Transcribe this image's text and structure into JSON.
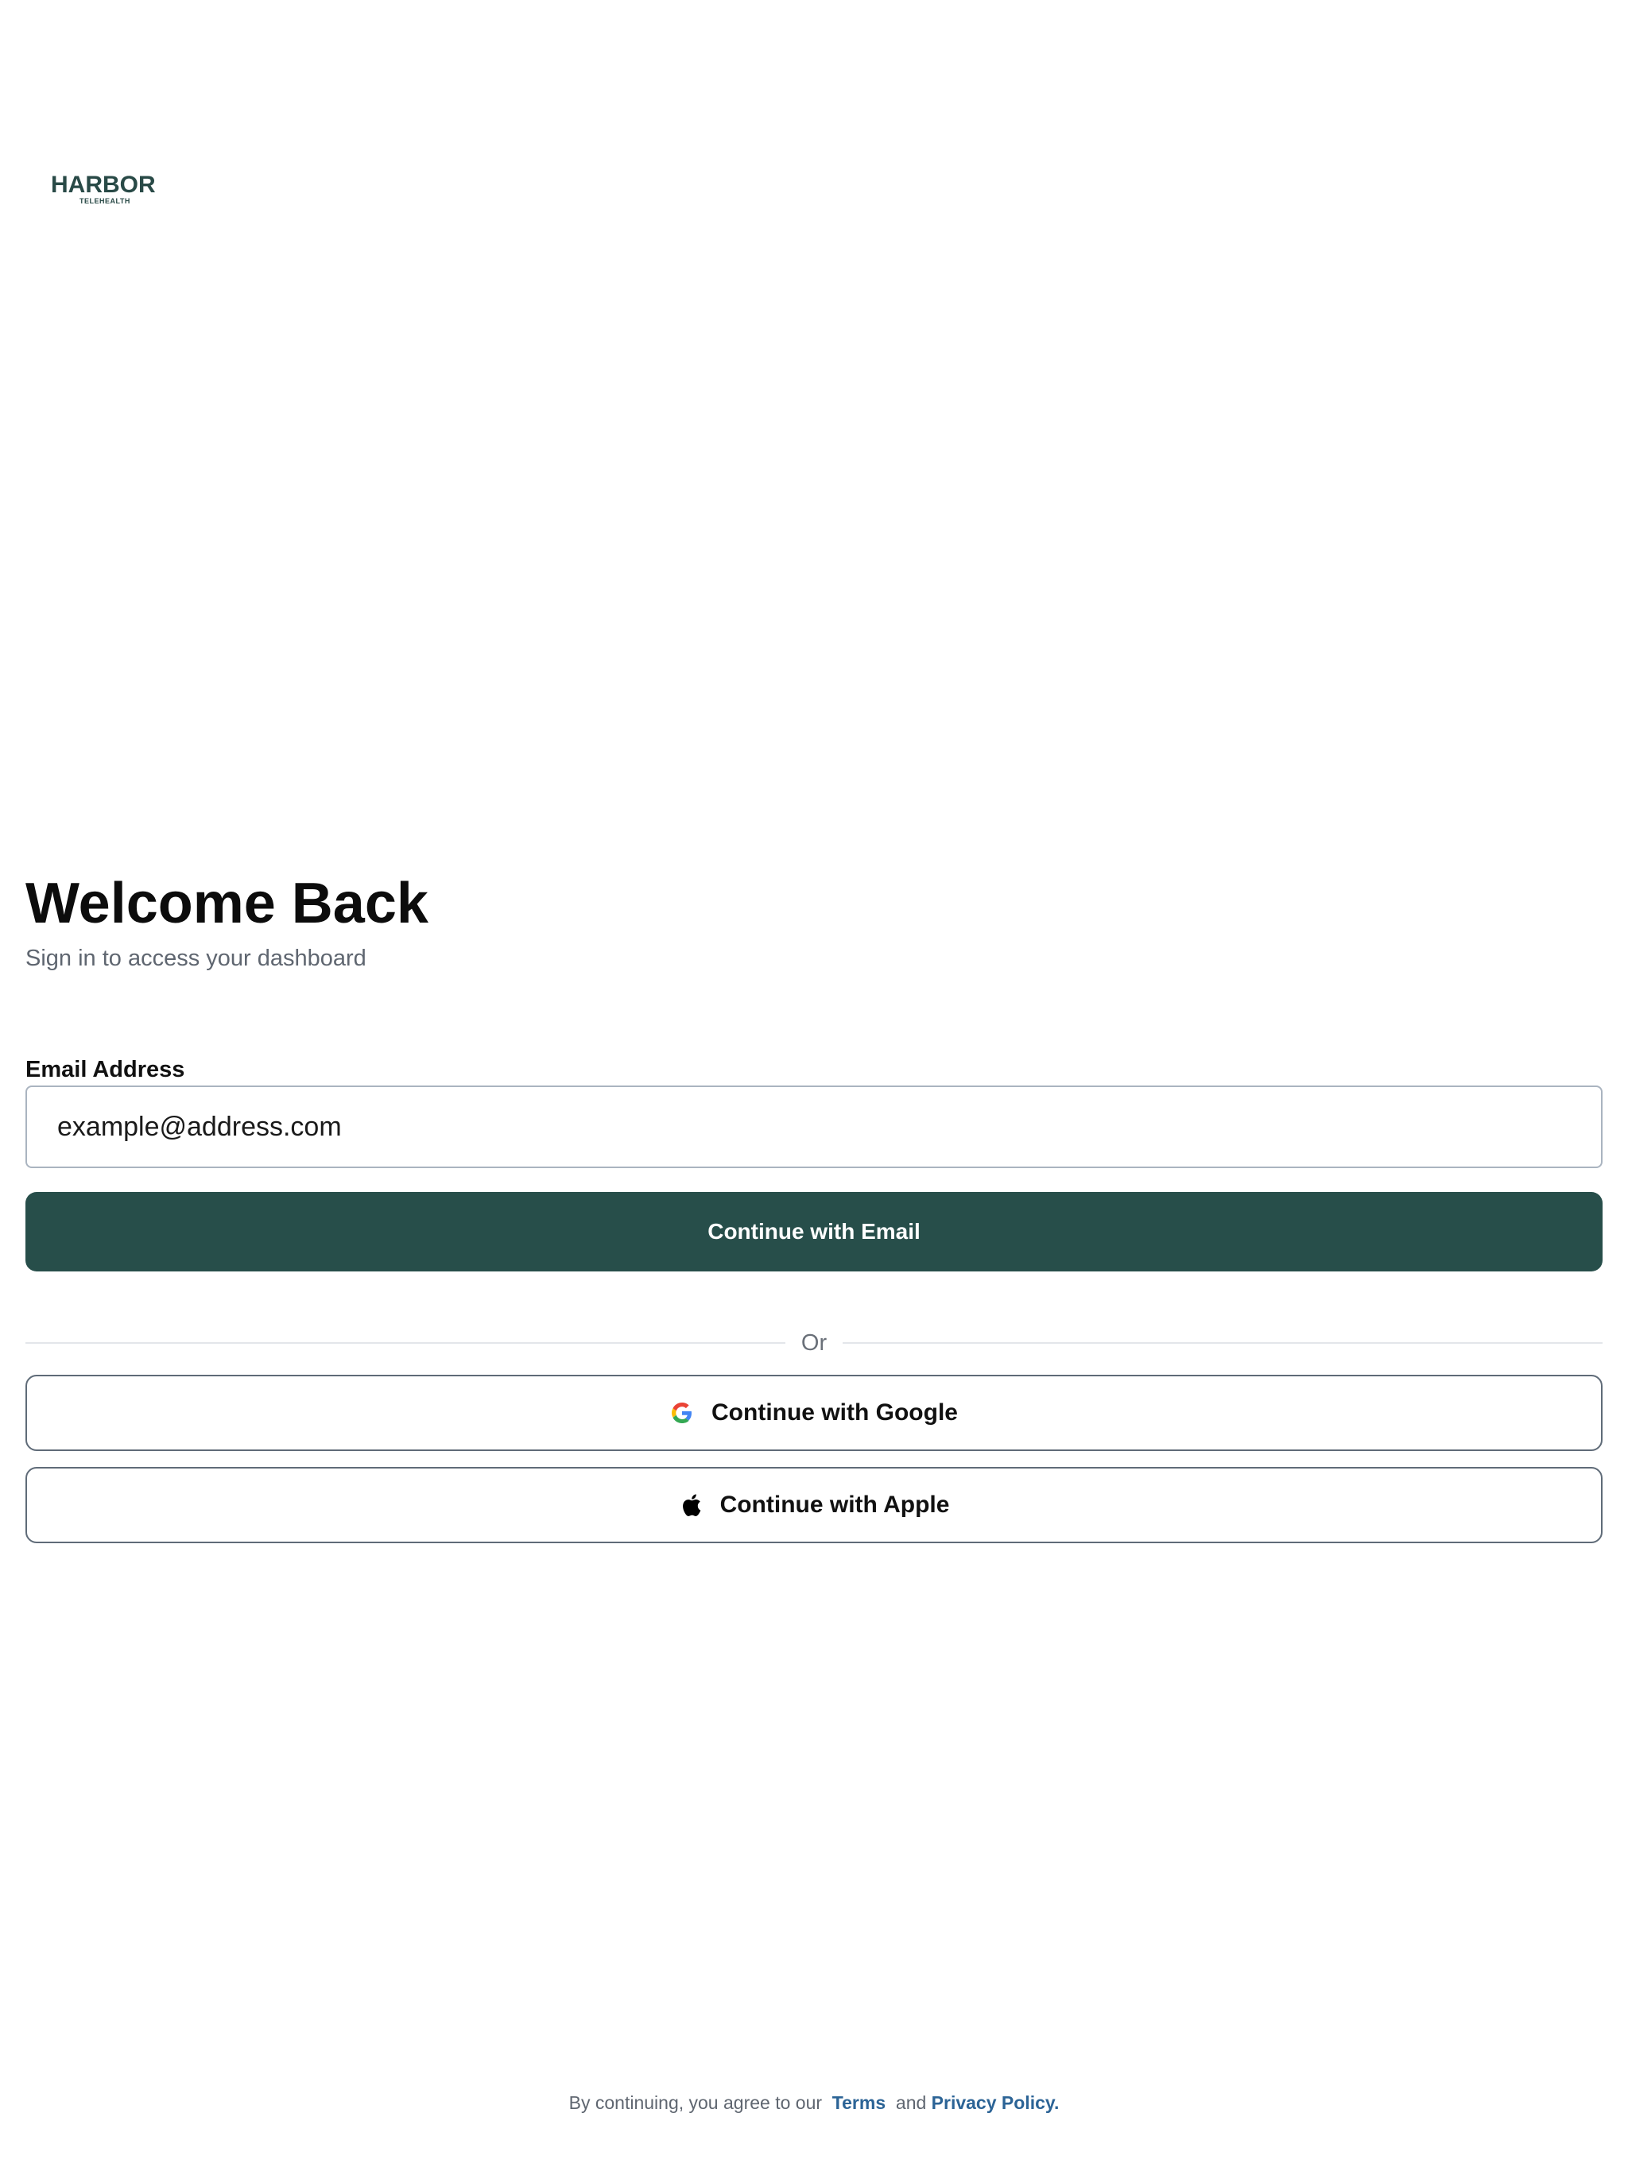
{
  "brand": {
    "name": "HARBOR",
    "tagline": "TELEHEALTH",
    "color": "#294a47"
  },
  "header": {
    "title": "Welcome Back",
    "subtitle": "Sign in to access your dashboard"
  },
  "form": {
    "email_label": "Email Address",
    "email_placeholder": "example@address.com",
    "email_value": "",
    "submit_label": "Continue with Email",
    "submit_color": "#274e4a"
  },
  "divider": {
    "label": "Or"
  },
  "social": {
    "google": {
      "label": "Continue with Google",
      "icon": "google-icon"
    },
    "apple": {
      "label": "Continue with Apple",
      "icon": "apple-icon"
    }
  },
  "footer": {
    "prefix": "By continuing, you agree to our",
    "terms": "Terms",
    "conjunction": "and",
    "privacy": "Privacy Policy."
  }
}
